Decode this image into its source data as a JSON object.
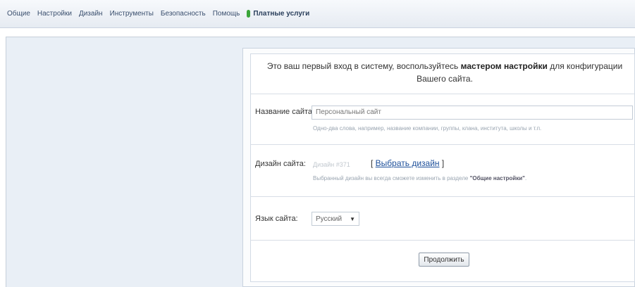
{
  "nav": {
    "items": [
      "Общие",
      "Настройки",
      "Дизайн",
      "Инструменты",
      "Безопасность",
      "Помощь"
    ],
    "paid_services": "Платные услуги",
    "paid_color": "#3aa53a"
  },
  "wizard": {
    "intro_before": "Это ваш первый вход в систему, воспользуйтесь ",
    "intro_bold": "мастером настройки",
    "intro_after": " для конфигурации Вашего сайта.",
    "site_name_label": "Название сайта:",
    "site_name_value": "Персональный сайт",
    "site_name_hint": "Одно-два слова, например, название компании, группы, клана, института, школы и т.п.",
    "design_label": "Дизайн сайта:",
    "design_value": "Дизайн #371",
    "choose_design": "Выбрать дизайн",
    "design_hint_before": "Выбранный дизайн вы всегда сможете изменить в разделе ",
    "design_hint_bold": "\"Общие настройки\"",
    "design_hint_after": ".",
    "language_label": "Язык сайта:",
    "language_value": "Русский",
    "continue_button": "Продолжить"
  }
}
